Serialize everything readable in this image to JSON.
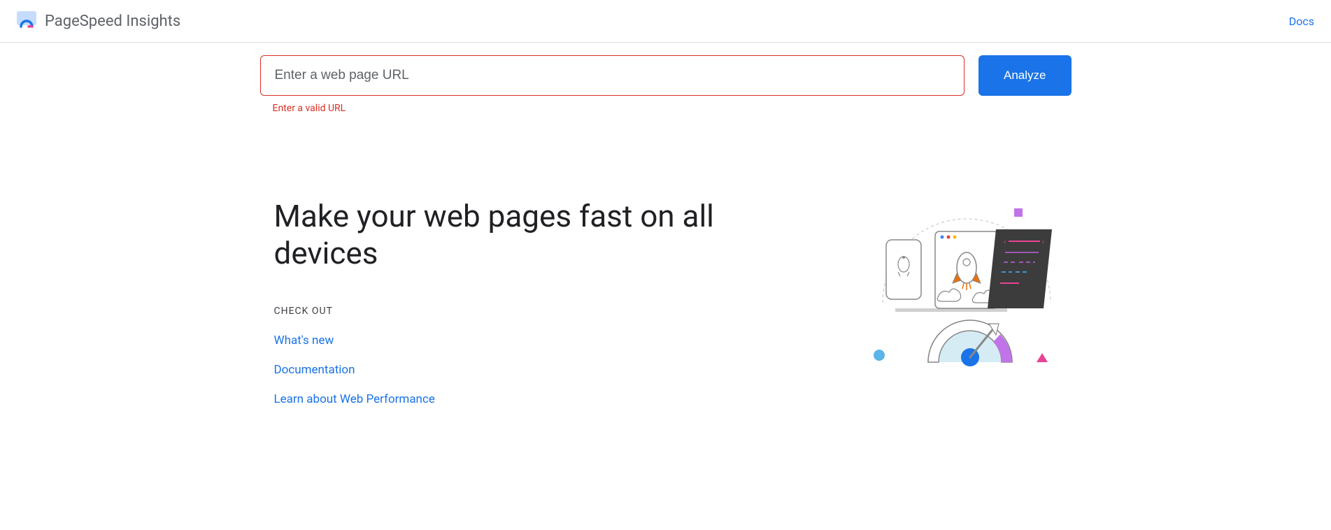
{
  "header": {
    "title": "PageSpeed Insights",
    "docs_link": "Docs"
  },
  "search": {
    "placeholder": "Enter a web page URL",
    "error": "Enter a valid URL",
    "button": "Analyze"
  },
  "content": {
    "headline": "Make your web pages fast on all devices",
    "checkout_label": "CHECK OUT",
    "links": [
      "What's new",
      "Documentation",
      "Learn about Web Performance"
    ]
  }
}
